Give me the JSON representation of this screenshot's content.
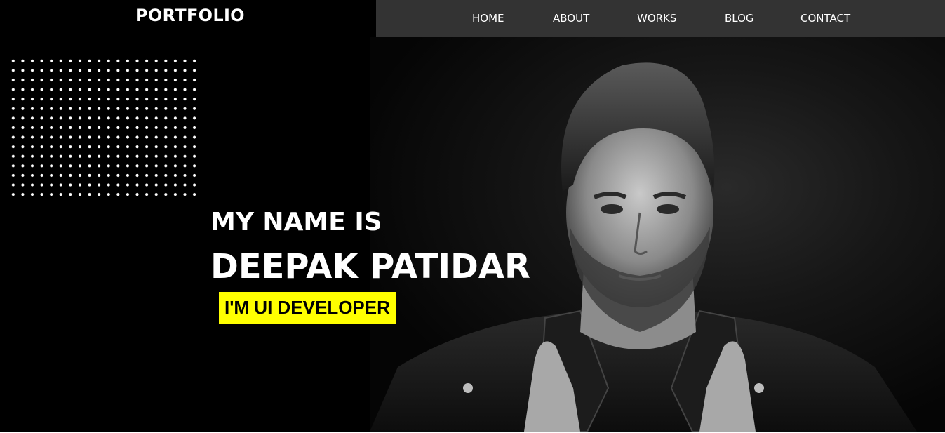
{
  "brand": {
    "logo_text": "PORTFOLIO"
  },
  "nav": {
    "items": [
      {
        "label": "HOME"
      },
      {
        "label": "ABOUT"
      },
      {
        "label": "WORKS"
      },
      {
        "label": "BLOG"
      },
      {
        "label": "CONTACT"
      }
    ]
  },
  "hero": {
    "intro": "MY NAME IS",
    "name": "DEEPAK PATIDAR",
    "role": "I'M UI DEVELOPER",
    "photo_description": "black and white portrait"
  },
  "colors": {
    "background": "#000000",
    "navbar": "#333333",
    "accent": "#ffff00",
    "text": "#ffffff"
  }
}
